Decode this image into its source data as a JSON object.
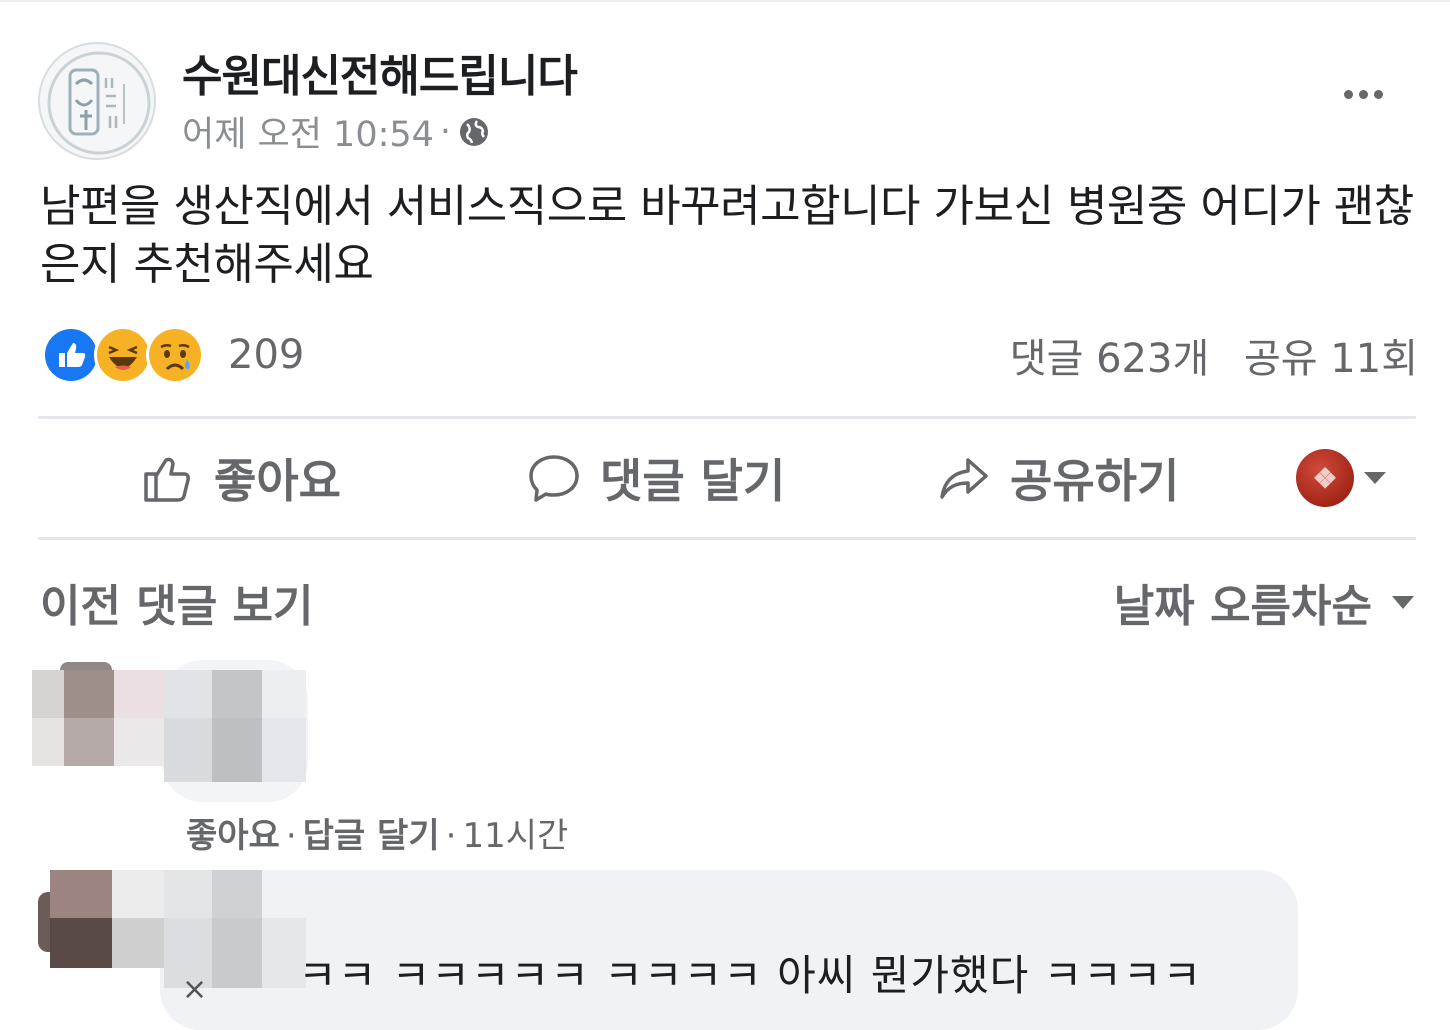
{
  "post": {
    "page_name": "수원대신전해드립니다",
    "time": "어제 오전 10:54",
    "meta_separator": "·",
    "text": "남편을 생산직에서 서비스직으로 바꾸려고합니다 가보신 병원중 어디가 괜찮은지 추천해주세요",
    "avatar_icon": "page-logo-icon",
    "privacy_icon": "globe-icon"
  },
  "reactions": {
    "types": [
      "like",
      "haha",
      "sad"
    ],
    "colors": {
      "like": "#1877f2",
      "haha": "#f7b125",
      "sad": "#f7b125"
    },
    "count": "209"
  },
  "stats": {
    "comments": "댓글 623개",
    "shares": "공유 11회"
  },
  "actions": {
    "like": "좋아요",
    "comment": "댓글 달기",
    "share": "공유하기"
  },
  "comments_header": {
    "previous": "이전 댓글 보기",
    "sort": "날짜 오름차순"
  },
  "comments": [
    {
      "author": "",
      "text": "",
      "actions": {
        "like": "좋아요",
        "reply": "답글 달기",
        "time": "11시간",
        "separator": "·"
      }
    },
    {
      "author": "",
      "text": "ㅋㅋ ㅋㅋㅋㅋㅋ ㅋㅋㅋㅋ 아씨 뭔가했다 ㅋㅋㅋㅋ",
      "close_glyph": "×"
    }
  ]
}
